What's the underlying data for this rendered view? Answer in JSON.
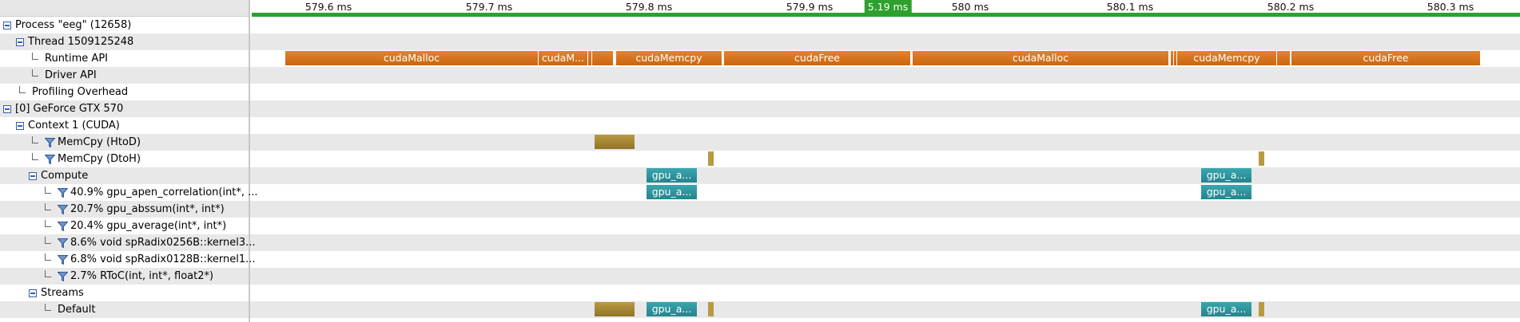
{
  "colors": {
    "api": "#d97419",
    "memcpy": "#a6883a",
    "kernel": "#2f979f",
    "cursor": "#2ea02e"
  },
  "ruler": {
    "cursor_label": "5.19 ms",
    "ticks": [
      "579.6 ms",
      "579.7 ms",
      "579.8 ms",
      "579.9 ms",
      "580 ms",
      "580.1 ms",
      "580.2 ms",
      "580.3 ms"
    ]
  },
  "tree": {
    "process": "Process \"eeg\" (12658)",
    "thread": "Thread 1509125248",
    "runtime_api": "Runtime API",
    "driver_api": "Driver API",
    "profiling_overhead": "Profiling Overhead",
    "device": "[0] GeForce GTX 570",
    "context": "Context 1 (CUDA)",
    "memcpy_htod": "MemCpy (HtoD)",
    "memcpy_dtoh": "MemCpy (DtoH)",
    "compute": "Compute",
    "kernel_1": "40.9% gpu_apen_correlation(int*, ...",
    "kernel_2": "20.7% gpu_abssum(int*, int*)",
    "kernel_3": "20.4% gpu_average(int*, int*)",
    "kernel_4": "8.6% void spRadix0256B::kernel3...",
    "kernel_5": "6.8% void spRadix0128B::kernel1...",
    "kernel_6": "2.7% RToC(int, int*, float2*)",
    "streams": "Streams",
    "default_stream": "Default"
  },
  "timeline": {
    "runtime_api": [
      "cudaMalloc",
      "cudaM...",
      "",
      "",
      "cudaMemcpy",
      "cudaFree",
      "cudaMalloc",
      "",
      "",
      "cudaMemcpy",
      "",
      "cudaFree"
    ],
    "compute_label": "gpu_a...",
    "kernel_label": "gpu_a...",
    "stream_kernel_label": "gpu_a..."
  }
}
